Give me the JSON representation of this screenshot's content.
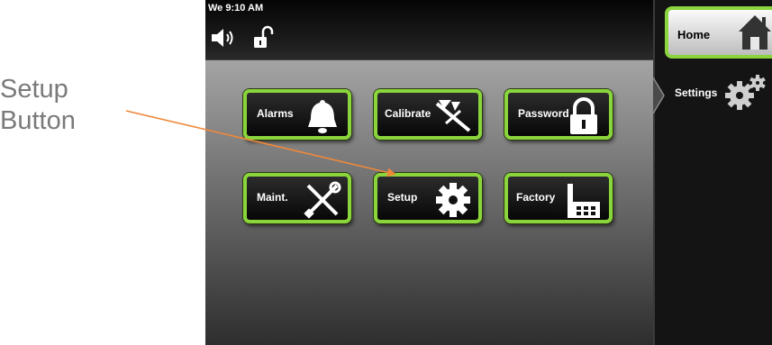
{
  "annotation": {
    "line1": "Setup",
    "line2": "Button",
    "arrow_color": "#f0883a"
  },
  "status_bar": {
    "time": "We 9:10 AM",
    "sound_icon": "speaker-icon",
    "lock_icon": "unlocked-padlock-icon"
  },
  "menu": {
    "buttons": [
      {
        "label": "Alarms",
        "icon": "bell-icon"
      },
      {
        "label": "Calibrate",
        "icon": "caliper-icon"
      },
      {
        "label": "Password",
        "icon": "padlock-icon"
      },
      {
        "label": "Maint.",
        "icon": "tools-icon"
      },
      {
        "label": "Setup",
        "icon": "gear-icon"
      },
      {
        "label": "Factory",
        "icon": "factory-icon"
      }
    ]
  },
  "sidebar": {
    "home_label": "Home",
    "home_icon": "house-icon",
    "settings_label": "Settings",
    "settings_icon": "gears-icon"
  },
  "colors": {
    "button_border": "#8ad43c",
    "button_bg": "#111111",
    "arrow": "#f0883a"
  }
}
